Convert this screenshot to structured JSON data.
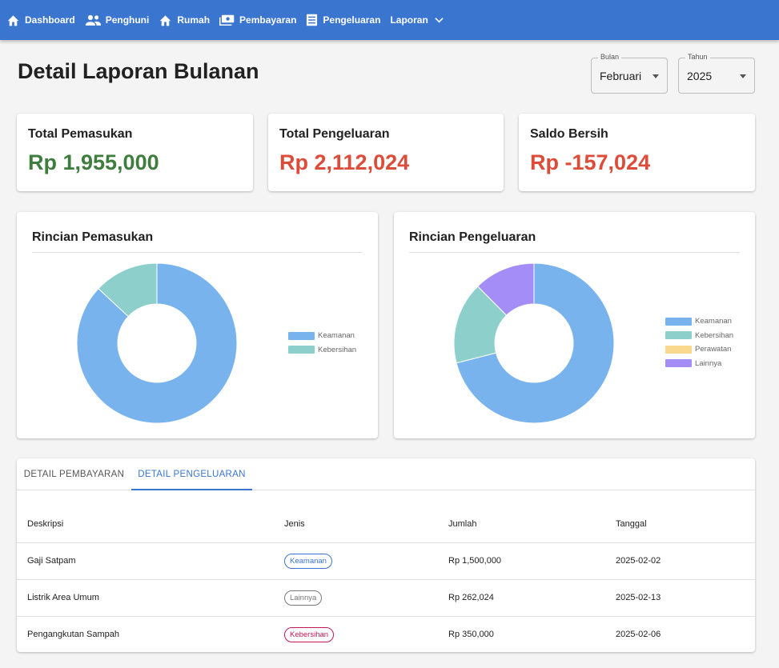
{
  "nav": {
    "items": [
      {
        "label": "Dashboard",
        "icon": "home-icon"
      },
      {
        "label": "Penghuni",
        "icon": "people-icon"
      },
      {
        "label": "Rumah",
        "icon": "house-icon"
      },
      {
        "label": "Pembayaran",
        "icon": "payments-icon"
      },
      {
        "label": "Pengeluaran",
        "icon": "receipt-icon"
      },
      {
        "label": "Laporan",
        "icon": "chevron-down-icon"
      }
    ]
  },
  "page": {
    "title": "Detail Laporan Bulanan"
  },
  "filters": {
    "month": {
      "label": "Bulan",
      "value": "Februari"
    },
    "year": {
      "label": "Tahun",
      "value": "2025"
    }
  },
  "stats": [
    {
      "title": "Total Pemasukan",
      "value": "Rp 1,955,000",
      "color": "#3e7d3e"
    },
    {
      "title": "Total Pengeluaran",
      "value": "Rp 2,112,024",
      "color": "#dd4b39"
    },
    {
      "title": "Saldo Bersih",
      "value": "Rp -157,024",
      "color": "#dd4b39"
    }
  ],
  "chart_data": [
    {
      "type": "pie",
      "title": "Rincian Pemasukan",
      "categories": [
        "Keamanan",
        "Kebersihan"
      ],
      "values": [
        1700000,
        255000
      ],
      "colors": [
        "#78b3ee",
        "#8dcfcb"
      ],
      "donut": true,
      "legend_position": "right"
    },
    {
      "type": "pie",
      "title": "Rincian Pengeluaran",
      "categories": [
        "Keamanan",
        "Kebersihan",
        "Perawatan",
        "Lainnya"
      ],
      "values": [
        1500000,
        350000,
        0,
        262024
      ],
      "colors": [
        "#78b3ee",
        "#8dcfcb",
        "#fad98e",
        "#a58df7"
      ],
      "donut": true,
      "legend_position": "right"
    }
  ],
  "tabs": [
    {
      "label": "DETAIL PEMBAYARAN",
      "active": false
    },
    {
      "label": "DETAIL PENGELUARAN",
      "active": true
    }
  ],
  "table": {
    "columns": [
      "Deskripsi",
      "Jenis",
      "Jumlah",
      "Tanggal"
    ],
    "rows": [
      {
        "desc": "Gaji Satpam",
        "type": "Keamanan",
        "type_color": "#3a75d0",
        "amount": "Rp 1,500,000",
        "date": "2025-02-02"
      },
      {
        "desc": "Listrik Area Umum",
        "type": "Lainnya",
        "type_color": "#777777",
        "amount": "Rp 262,024",
        "date": "2025-02-13"
      },
      {
        "desc": "Pengangkutan Sampah",
        "type": "Kebersihan",
        "type_color": "#c2185b",
        "amount": "Rp 350,000",
        "date": "2025-02-06"
      }
    ]
  }
}
